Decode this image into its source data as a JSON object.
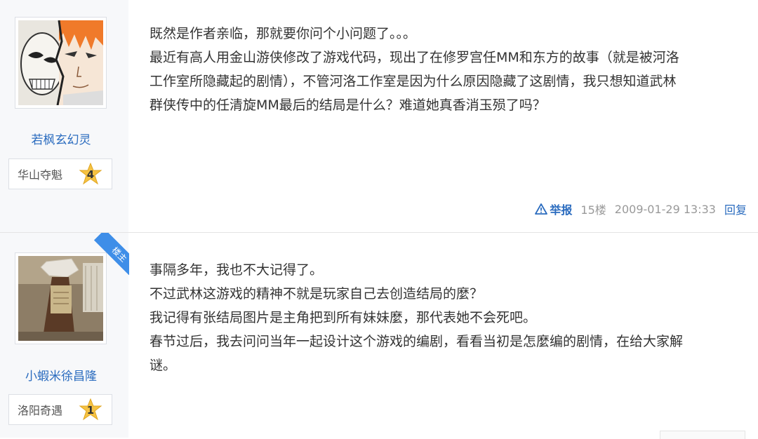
{
  "posts": [
    {
      "username": "若枫玄幻灵",
      "rank_title": "华山夺魁",
      "rank_level": "4",
      "lines": [
        "既然是作者亲临，那就要你问个小问题了。。。",
        "最近有高人用金山游侠修改了游戏代码，现出了在修罗宫任MM和东方的故事（就是被河洛",
        "工作室所隐藏起的剧情），不管河洛工作室是因为什么原因隐藏了这剧情，我只想知道武林",
        "群侠传中的任清旋MM最后的结局是什么？难道她真香消玉殒了吗？"
      ],
      "report_label": "举报",
      "floor": "15楼",
      "time": "2009-01-29 13:33",
      "reply_label": "回复"
    },
    {
      "badge": "楼主",
      "username": "小蝦米徐昌隆",
      "rank_title": "洛阳奇遇",
      "rank_level": "1",
      "lines": [
        "事隔多年，我也不大记得了。",
        "不过武林这游戏的精神不就是玩家自己去创造结局的麼？",
        "我记得有张结局图片是主角把到所有妹妹麼，那代表她不会死吧。",
        "春节过后，我去问问当年一起设计这个游戏的编剧，看看当初是怎麼编的剧情，在给大家解",
        "谜。"
      ]
    }
  ],
  "colors": {
    "link": "#2b6cbf",
    "sidebar_bg": "#f7f8fa",
    "badge_bg": "#3e8ee8",
    "star": "#f5c242"
  }
}
